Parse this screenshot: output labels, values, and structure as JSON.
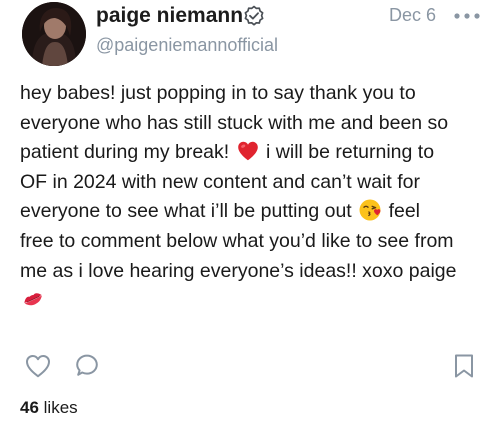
{
  "post": {
    "author": {
      "display_name": "paige niemann",
      "handle": "@paigeniemannofficial",
      "verified": true,
      "avatar_icon": "profile-photo"
    },
    "date": "Dec 6",
    "more_icon": "more-horizontal-icon",
    "text_lines": [
      "hey babes! just popping in to say thank you to",
      "everyone who has still stuck with me and been so",
      "patient during my break!",
      "i will be returning to",
      "OF in 2024 with new content and can’t wait for",
      "everyone to see what i’ll be putting out",
      "feel",
      "free to comment below what you’d like to see from",
      "me as i love hearing everyone’s ideas!! xoxo paige"
    ],
    "emojis": {
      "heart": "red-heart-emoji",
      "kiss_face": "face-blowing-kiss-emoji",
      "lips": "kiss-mark-emoji"
    },
    "actions": {
      "like_icon": "heart-outline-icon",
      "comment_icon": "comment-bubble-icon",
      "bookmark_icon": "bookmark-icon"
    },
    "likes": {
      "count": "46",
      "label": "likes"
    },
    "colors": {
      "text": "#1a1a1a",
      "muted": "#8a96a3",
      "icon": "#8a96a3",
      "heart_emoji": "#e0242f"
    }
  }
}
